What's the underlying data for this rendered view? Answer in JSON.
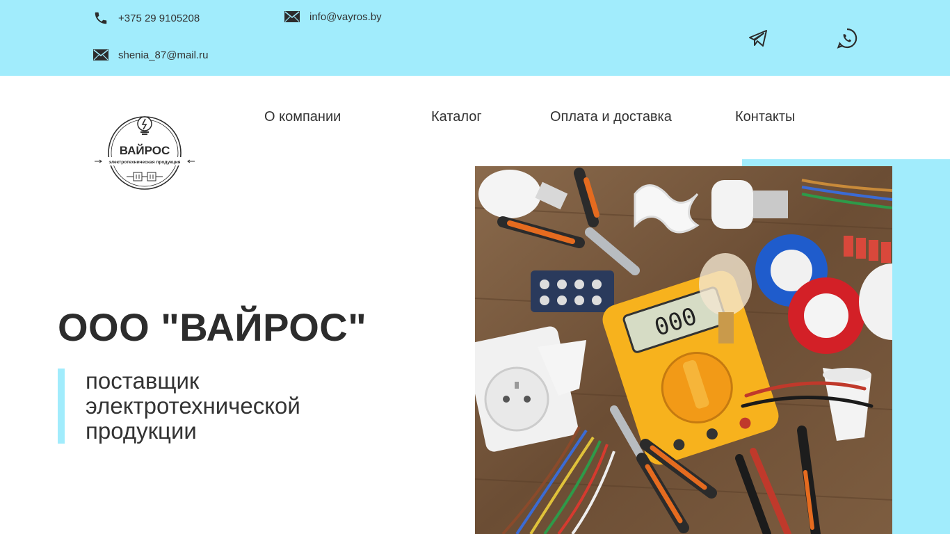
{
  "topbar": {
    "phone": "+375 29 9105208",
    "email_primary": "info@vayros.by",
    "email_secondary": "shenia_87@mail.ru",
    "social": [
      "telegram-icon",
      "whatsapp-icon"
    ],
    "background": "#a1ecfc"
  },
  "logo": {
    "name": "ВАЙРОС",
    "tagline": "электротехническая продукция"
  },
  "nav": {
    "items": [
      {
        "label": "О компании"
      },
      {
        "label": "Каталог"
      },
      {
        "label": "Оплата и доставка"
      },
      {
        "label": "Контакты"
      }
    ]
  },
  "hero": {
    "title": "ООО \"ВАЙРОС\"",
    "subtitle_lines": [
      "поставщик",
      "электротехнической",
      "продукции"
    ],
    "image": "electrical-tools-photo",
    "accent": "#a1ecfc"
  }
}
